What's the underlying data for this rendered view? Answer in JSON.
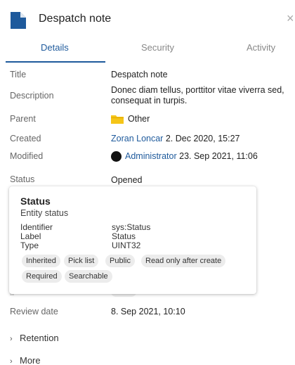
{
  "header": {
    "title": "Despatch note",
    "icon": "document-icon",
    "accent": "#1e5a9c"
  },
  "tabs": [
    {
      "label": "Details",
      "active": true
    },
    {
      "label": "Security",
      "active": false
    },
    {
      "label": "Activity",
      "active": false
    }
  ],
  "details": {
    "title": {
      "label": "Title",
      "value": "Despatch note"
    },
    "description": {
      "label": "Description",
      "value_line1": "Donec diam tellus, porttitor vitae viverra sed,",
      "value_line2": "consequat in turpis."
    },
    "parent": {
      "label": "Parent",
      "value": "Other",
      "icon": "folder-icon"
    },
    "created": {
      "label": "Created",
      "user": "Zoran Loncar",
      "date": "2. Dec 2020, 15:27"
    },
    "modified": {
      "label": "Modified",
      "user": "Administrator",
      "date": "23. Sep 2021, 11:06"
    },
    "status": {
      "label": "Status",
      "value": "Opened"
    },
    "review_date": {
      "label": "Review date",
      "value": "8. Sep 2021, 10:10"
    }
  },
  "popup": {
    "title": "Status",
    "subtitle": "Entity status",
    "identifier_label": "Identifier",
    "identifier_value": "sys:Status",
    "label_label": "Label",
    "label_value": "Status",
    "type_label": "Type",
    "type_value": "UINT32",
    "chips": [
      "Inherited",
      "Pick list",
      "Public",
      "Read only after create",
      "Required",
      "Searchable"
    ]
  },
  "sections": {
    "retention": "Retention",
    "more": "More"
  }
}
